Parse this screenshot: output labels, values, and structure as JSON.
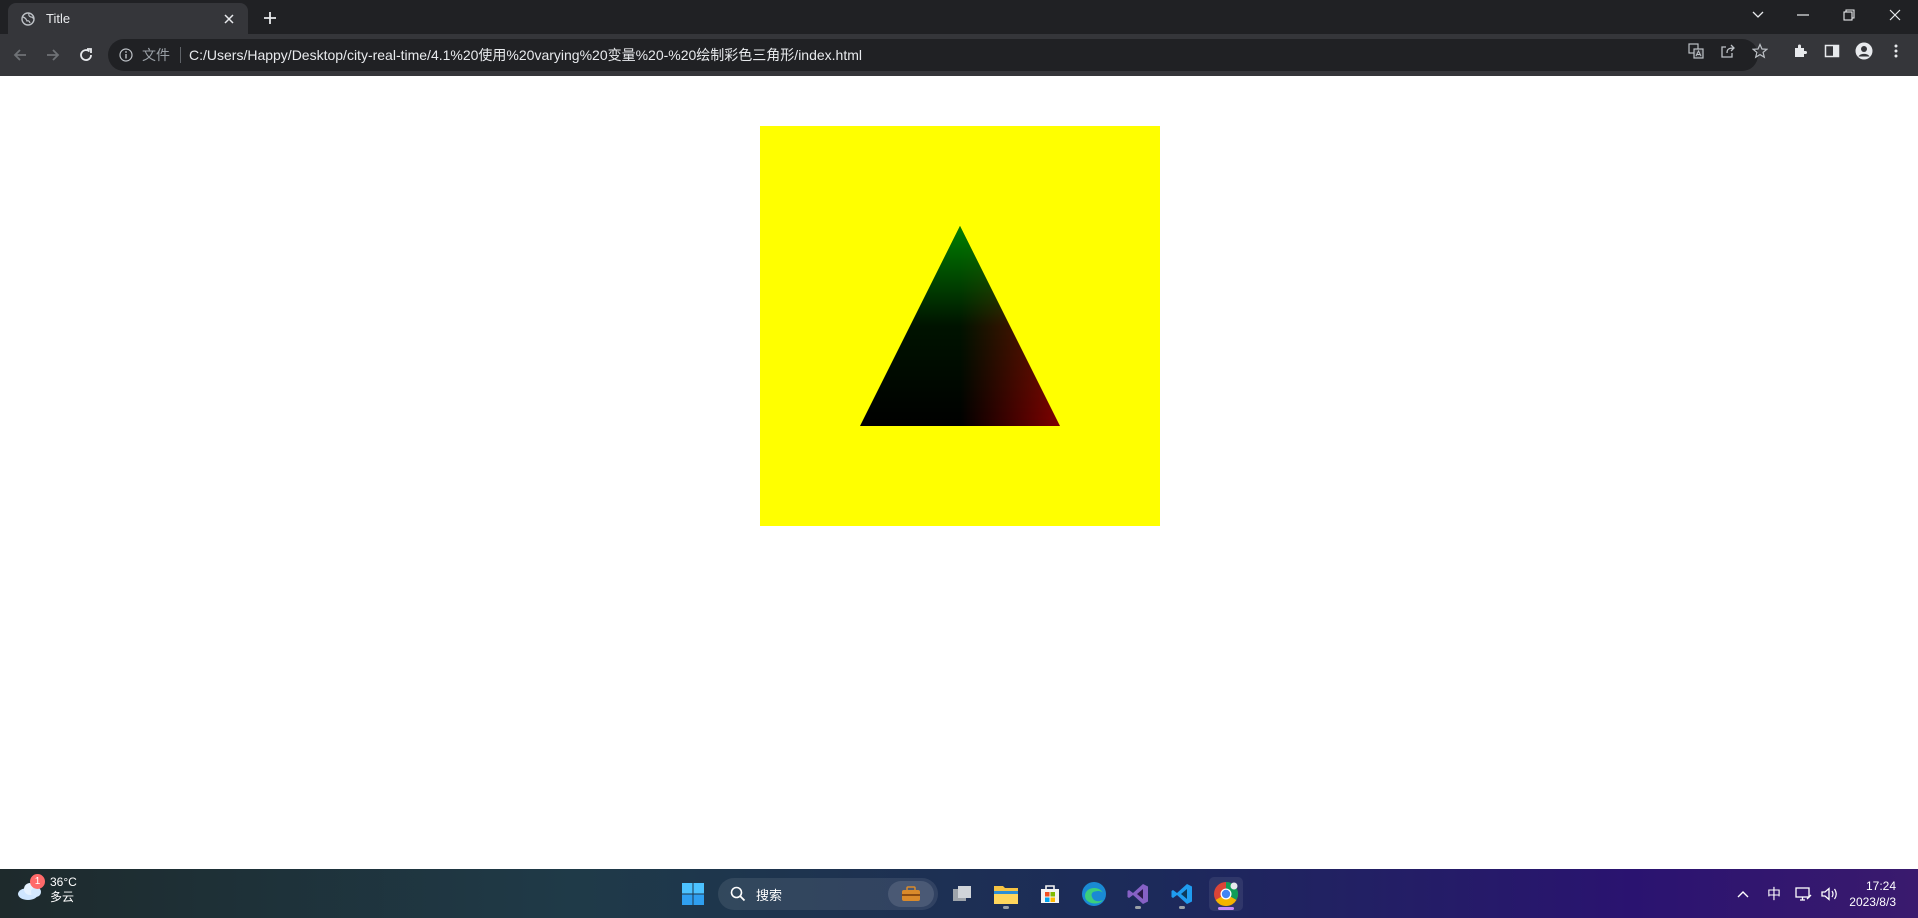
{
  "browser": {
    "tab": {
      "title": "Title"
    },
    "address_bar": {
      "scheme_label": "文件",
      "url": "C:/Users/Happy/Desktop/city-real-time/4.1%20使用%20varying%20变量%20-%20绘制彩色三角形/index.html"
    }
  },
  "page": {
    "canvas": {
      "clear_color": "#ffff00",
      "triangle": {
        "vertices": [
          {
            "position": [
              0.0,
              0.5
            ],
            "color": "#008000"
          },
          {
            "position": [
              -0.5,
              -0.5
            ],
            "color": "#000000"
          },
          {
            "position": [
              0.5,
              -0.5
            ],
            "color": "#800000"
          }
        ]
      }
    }
  },
  "taskbar": {
    "weather": {
      "temperature": "36°C",
      "condition": "多云",
      "badge_count": "1"
    },
    "search": {
      "label": "搜索"
    },
    "tray": {
      "ime": "中"
    },
    "clock": {
      "time": "17:24",
      "date": "2023/8/3"
    }
  },
  "colors": {
    "tab_strip": "#202124",
    "toolbar": "#35363a",
    "canvas_background": "#ffff00"
  }
}
